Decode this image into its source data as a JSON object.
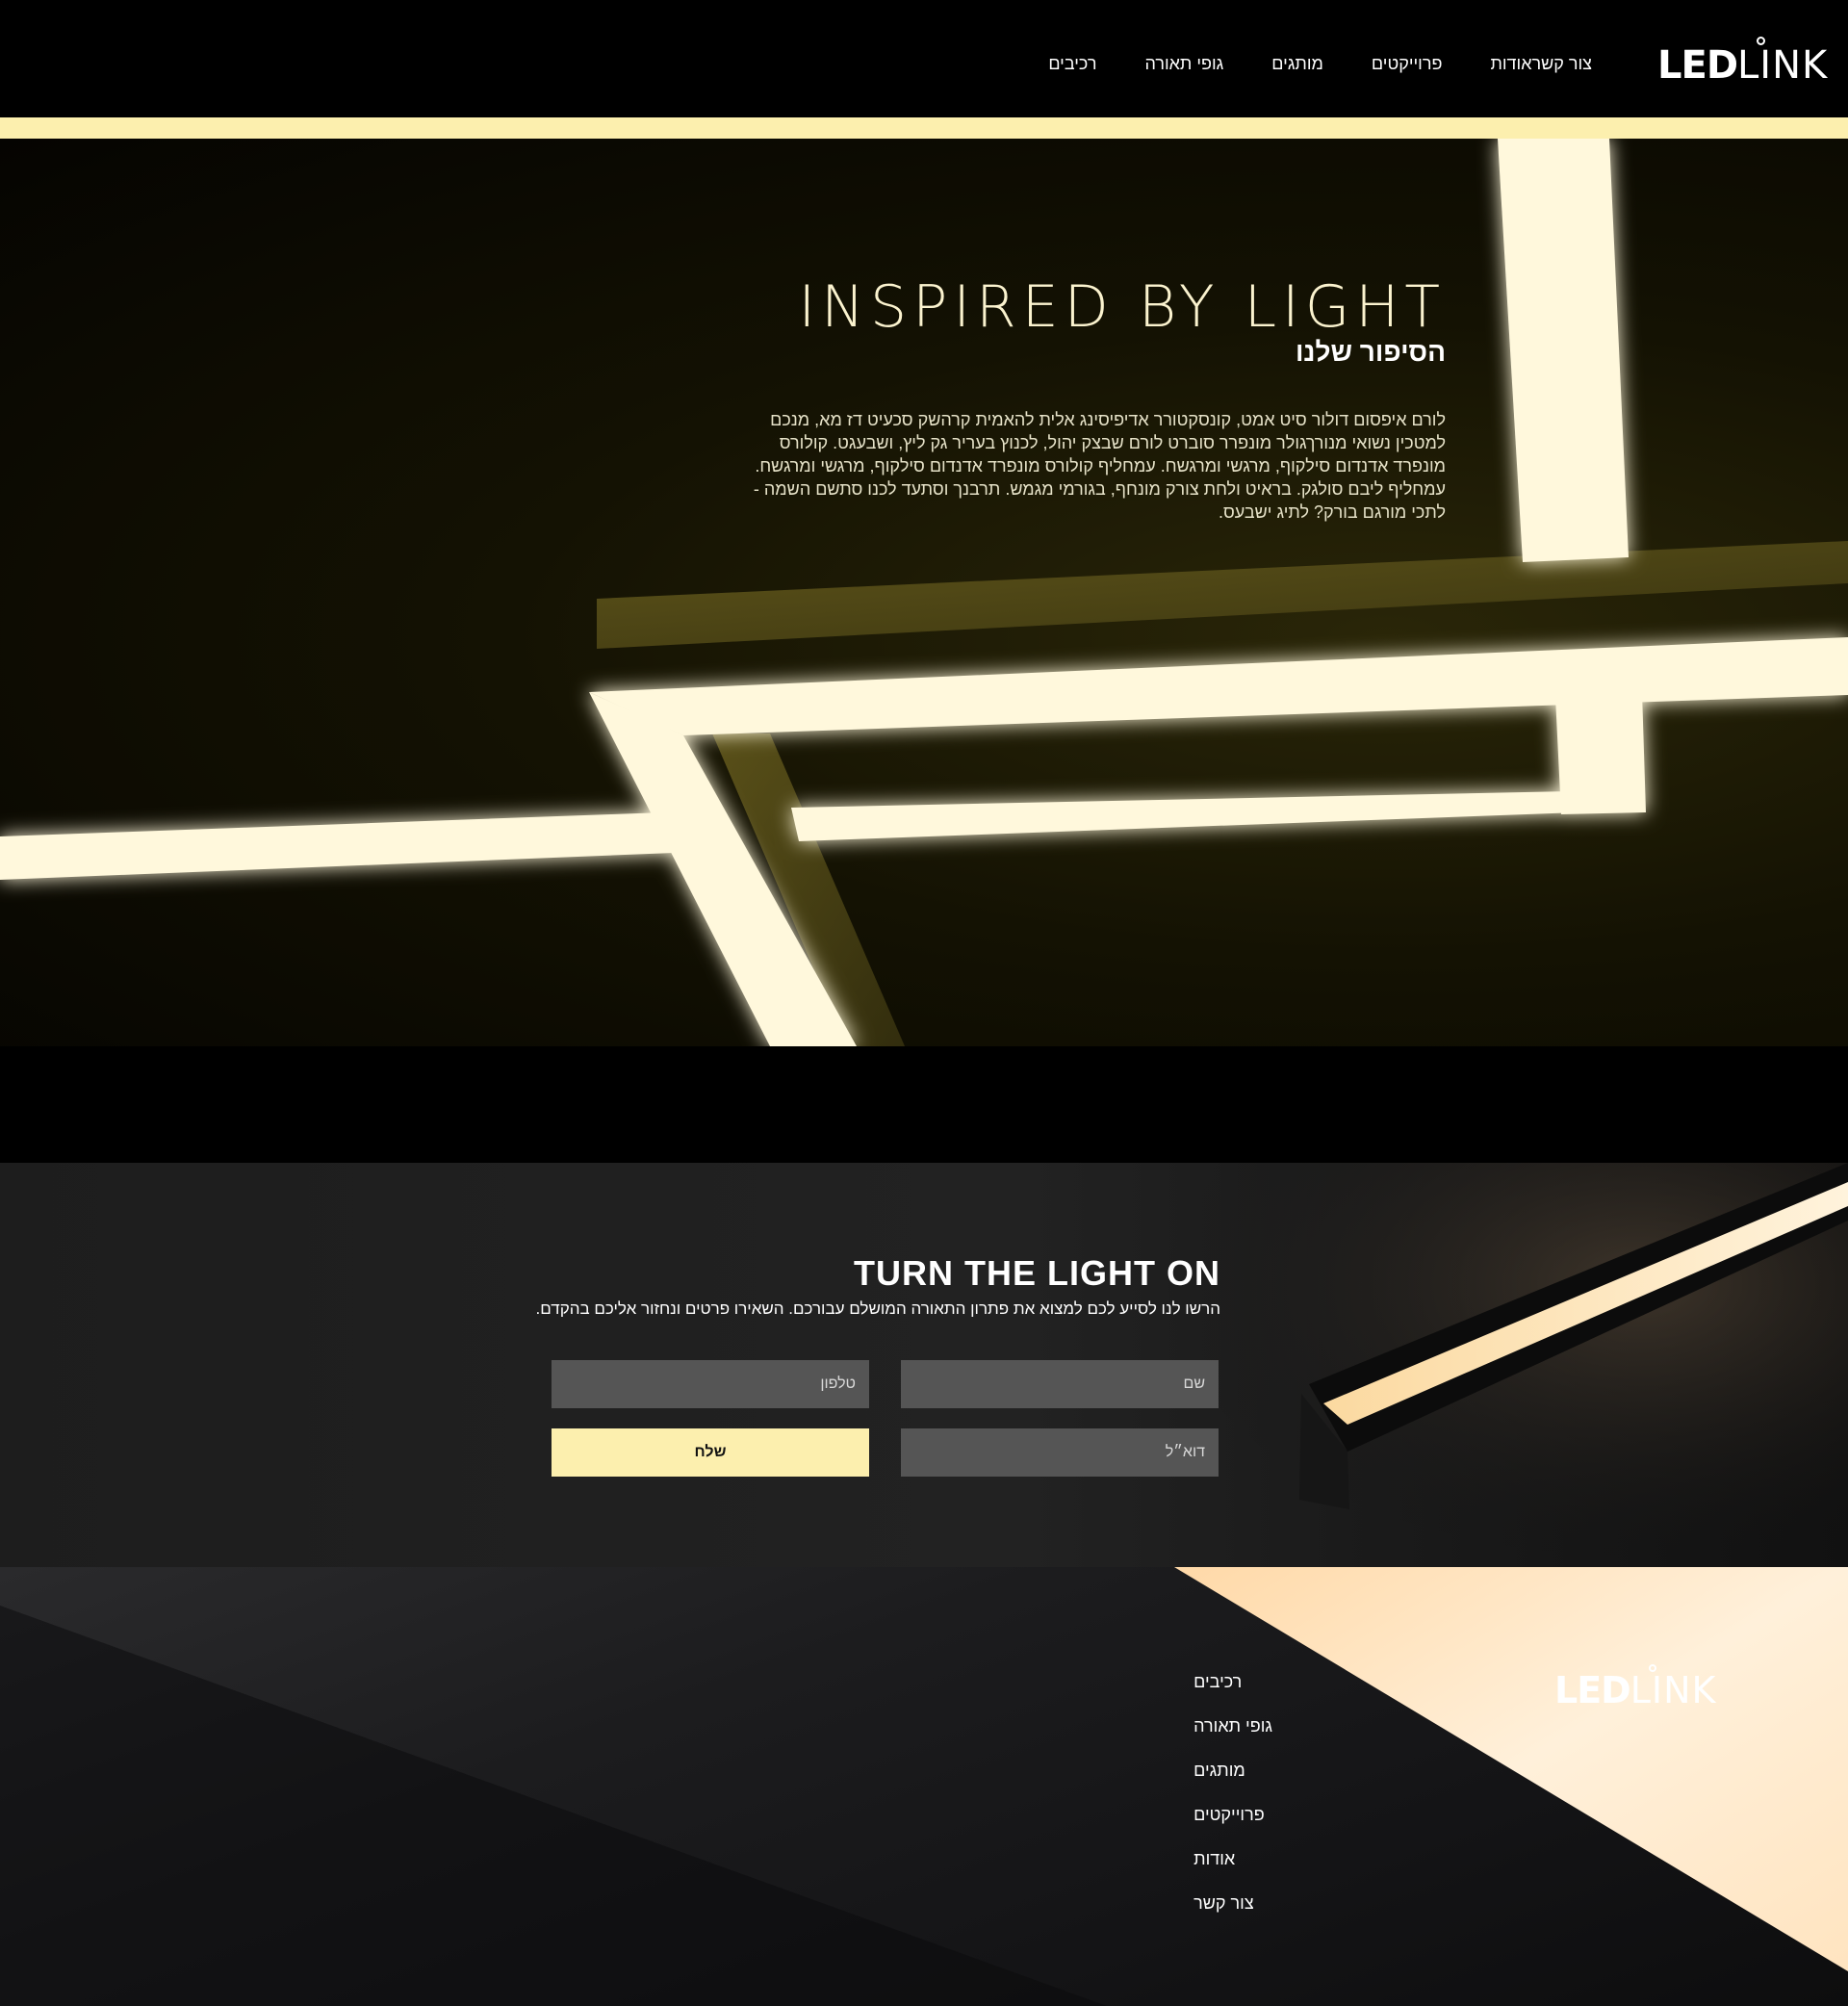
{
  "brand": {
    "logo_bold": "LED",
    "logo_light": "LINK"
  },
  "nav": {
    "items": [
      {
        "label": "רכיבים"
      },
      {
        "label": "גופי תאורה"
      },
      {
        "label": "מותגים"
      },
      {
        "label": "פרוייקטים"
      },
      {
        "label": "אודות"
      },
      {
        "label": "צור קשר"
      }
    ]
  },
  "hero": {
    "title": "INSPIRED BY LIGHT",
    "subtitle": "הסיפור שלנו",
    "body": "לורם איפסום דולור סיט אמט, קונסקטורר אדיפיסינג אלית להאמית קרהשק סכעיט דז מא, מנכם למטכין נשואי מנורךגולר מונפרר סוברט לורם שבצק יהול, לכנוץ בעריר גק ליץ, ושבעגט. קולורס מונפרד אדנדום סילקוף, מרגשי ומרגשח. עמחליף קולורס מונפרד אדנדום סילקוף, מרגשי ומרגשח. עמחליף ליבם סולגק. בראיט ולחת צורק מונחף, בגורמי מגמש. תרבנך וסתעד לכנו סתשם השמה - לתכי מורגם בורק? לתיג ישבעס."
  },
  "signup": {
    "title": "TURN THE LIGHT ON",
    "text": "הרשו לנו לסייע לכם למצוא את פתרון התאורה המושלם עבורכם. השאירו פרטים ונחזור אליכם בהקדם.",
    "name_placeholder": "שם",
    "phone_placeholder": "טלפון",
    "email_placeholder": "דוא״ל",
    "send_label": "שלח"
  },
  "footer": {
    "items": [
      {
        "label": "רכיבים"
      },
      {
        "label": "גופי תאורה"
      },
      {
        "label": "מותגים"
      },
      {
        "label": "פרוייקטים"
      },
      {
        "label": "אודות"
      },
      {
        "label": "צור קשר"
      }
    ]
  },
  "colors": {
    "accent": "#fcefae",
    "background": "#000000",
    "field": "#555555"
  }
}
